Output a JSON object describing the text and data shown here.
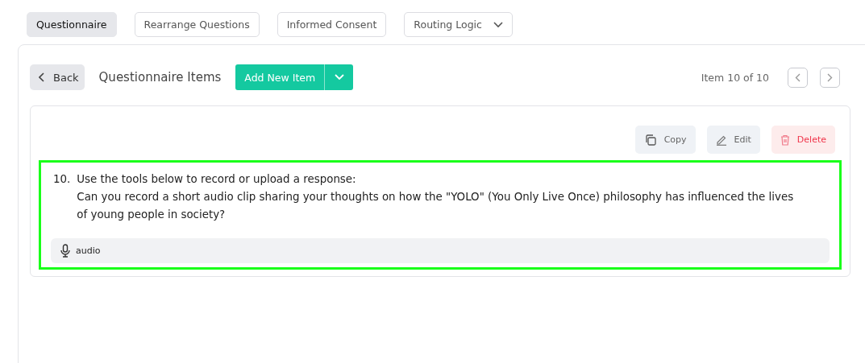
{
  "tabs": [
    {
      "label": "Questionnaire",
      "selected": true,
      "kind": "tab"
    },
    {
      "label": "Rearrange Questions",
      "selected": false,
      "kind": "tab"
    },
    {
      "label": "Informed Consent",
      "selected": false,
      "kind": "tab"
    },
    {
      "label": "Routing Logic",
      "selected": false,
      "kind": "dropdown"
    }
  ],
  "toolbar": {
    "back": "Back",
    "title": "Questionnaire Items",
    "add_button": "Add New Item",
    "pager": "Item 10 of 10"
  },
  "item": {
    "actions": [
      {
        "label": "Copy",
        "kind": "copy"
      },
      {
        "label": "Edit",
        "kind": "edit"
      },
      {
        "label": "Delete",
        "kind": "delete"
      }
    ],
    "highlighted": true,
    "number": "10.",
    "instruction": "Use the tools below to record or upload a response:",
    "question": "Can you record a short audio clip sharing your thoughts on how the \"YOLO\" (You Only Live Once) philosophy has influenced the lives of young people in society?",
    "response_type": "audio"
  }
}
